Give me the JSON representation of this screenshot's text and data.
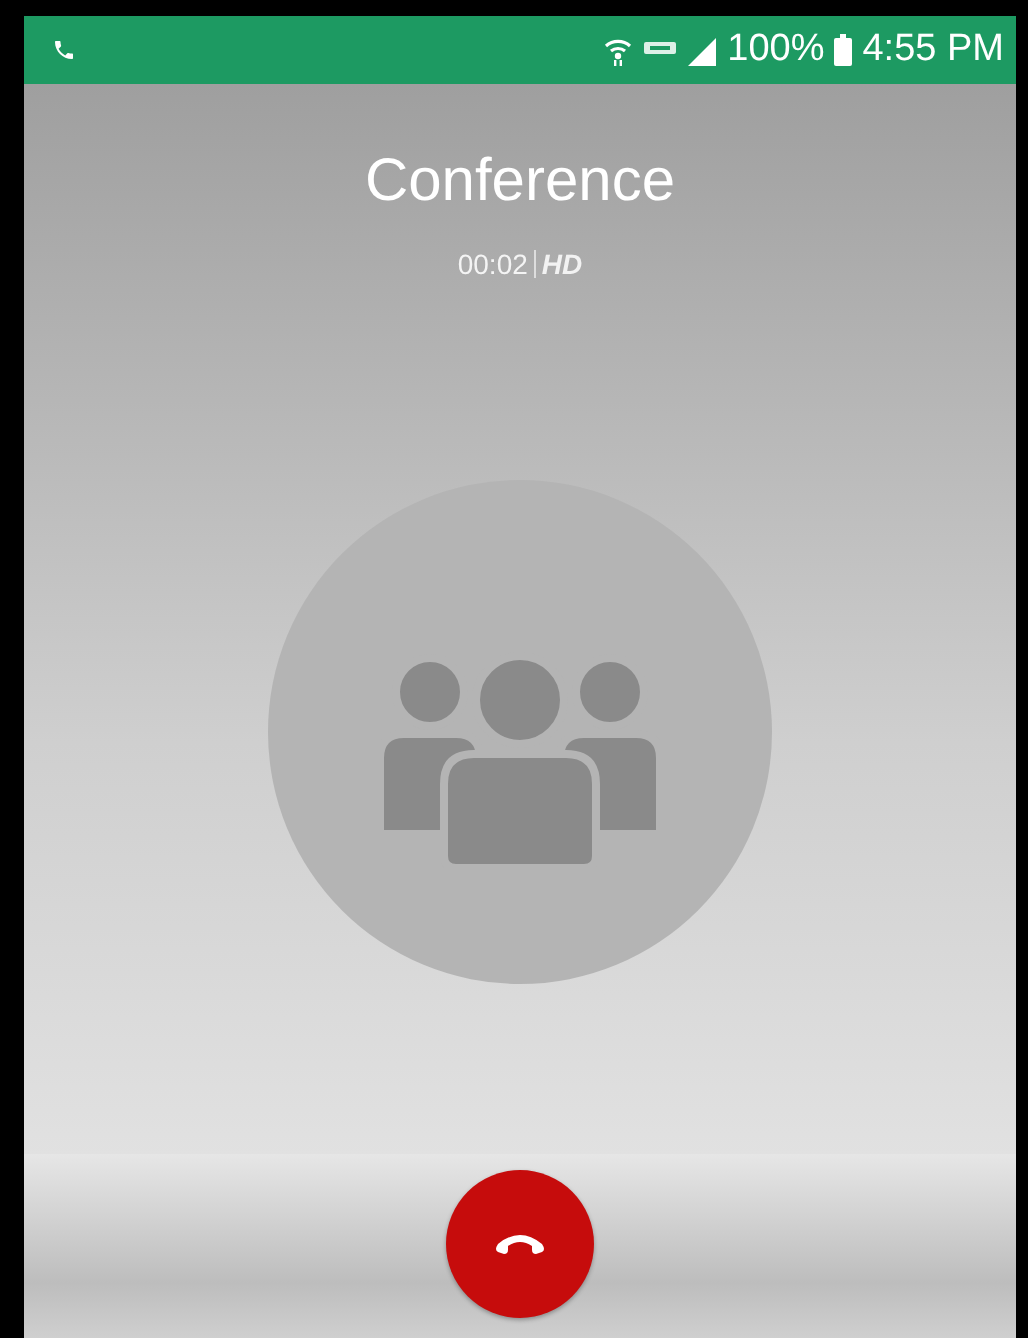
{
  "status_bar": {
    "battery": "100%",
    "time": "4:55 PM"
  },
  "call": {
    "title": "Conference",
    "duration": "00:02",
    "quality": "HD"
  }
}
